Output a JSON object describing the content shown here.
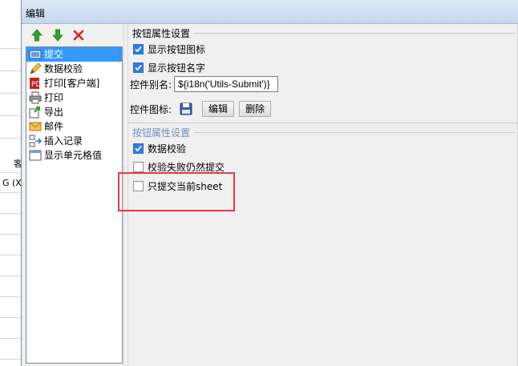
{
  "window": {
    "title": "编辑"
  },
  "background": {
    "frag1": "客",
    "frag2": "G (X"
  },
  "toolbar": {
    "move_up": "arrow-up-icon",
    "move_down": "arrow-down-icon",
    "delete": "delete-icon"
  },
  "actions": [
    {
      "label": "提交",
      "icon": "submit-icon",
      "selected": true
    },
    {
      "label": "数据校验",
      "icon": "pencil-icon",
      "selected": false
    },
    {
      "label": "打印[客户端]",
      "icon": "print-client-icon",
      "selected": false
    },
    {
      "label": "打印",
      "icon": "printer-icon",
      "selected": false
    },
    {
      "label": "导出",
      "icon": "export-icon",
      "selected": false
    },
    {
      "label": "邮件",
      "icon": "mail-icon",
      "selected": false
    },
    {
      "label": "插入记录",
      "icon": "insert-row-icon",
      "selected": false
    },
    {
      "label": "显示单元格值",
      "icon": "cell-icon",
      "selected": false
    }
  ],
  "button_settings": {
    "title": "按钮属性设置",
    "show_icon": {
      "label": "显示按钮图标",
      "checked": true
    },
    "show_name": {
      "label": "显示按钮名字",
      "checked": true
    },
    "alias_label": "控件别名:",
    "alias_value": "${i18n('Utils-Submit')}",
    "icon_label": "控件图标:",
    "edit_button": "编辑",
    "delete_button": "删除"
  },
  "submit_settings": {
    "title": "按钮属性设置",
    "validate": {
      "label": "数据校验",
      "checked": true
    },
    "submit_on_fail": {
      "label": "校验失败仍然提交",
      "checked": false
    },
    "current_sheet_only": {
      "label": "只提交当前sheet",
      "checked": false
    }
  },
  "colors": {
    "selection": "#3399ff",
    "highlight": "#e03c3c",
    "checkbox": "#2c7be5"
  }
}
